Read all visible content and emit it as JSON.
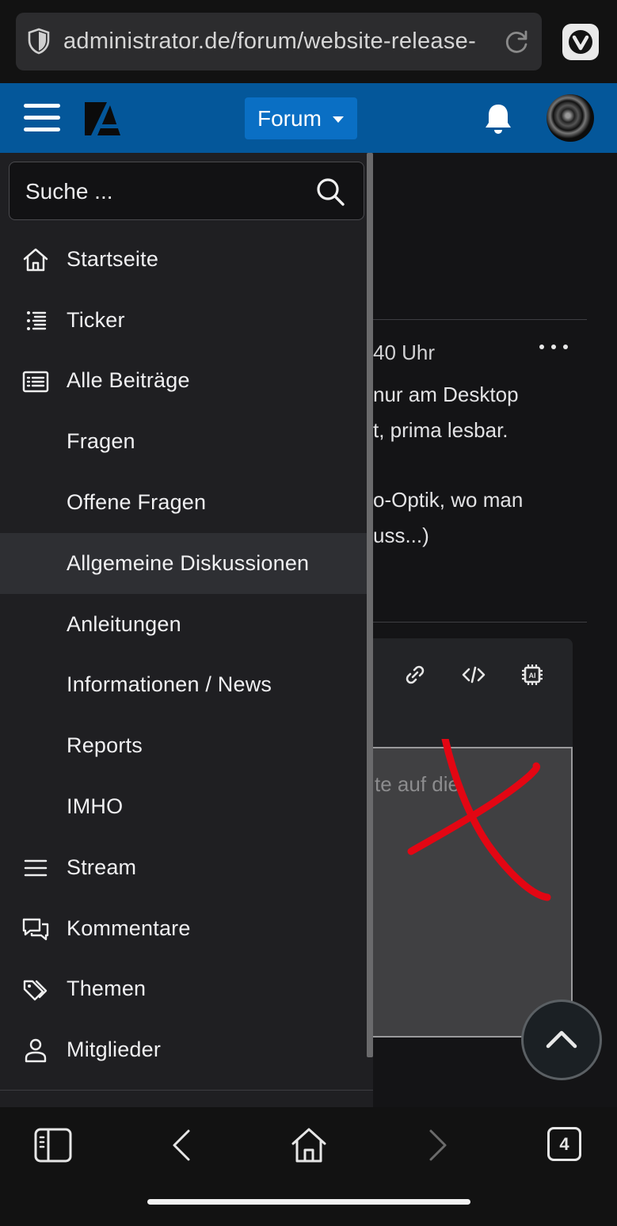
{
  "browser": {
    "url": "administrator.de/forum/website-release-",
    "tab_count": "4"
  },
  "header": {
    "forum_button": "Forum"
  },
  "search": {
    "placeholder": "Suche ..."
  },
  "menu": {
    "items": [
      {
        "label": "Startseite",
        "icon": "home-icon"
      },
      {
        "label": "Ticker",
        "icon": "ticker-list-icon"
      },
      {
        "label": "Alle Beiträge",
        "icon": "list-box-icon"
      },
      {
        "label": "Fragen"
      },
      {
        "label": "Offene Fragen"
      },
      {
        "label": "Allgemeine Diskussionen",
        "active": true
      },
      {
        "label": "Anleitungen"
      },
      {
        "label": "Informationen / News"
      },
      {
        "label": "Reports"
      },
      {
        "label": "IMHO"
      },
      {
        "label": "Stream",
        "icon": "stream-lines-icon"
      },
      {
        "label": "Kommentare",
        "icon": "comments-icon"
      },
      {
        "label": "Themen",
        "icon": "tags-icon"
      },
      {
        "label": "Mitglieder",
        "icon": "user-icon"
      }
    ]
  },
  "content": {
    "time": "40 Uhr",
    "lines": [
      "nur am Desktop",
      "t, prima lesbar.",
      "o-Optik, wo man",
      "uss...)"
    ],
    "editor_placeholder": "te auf die"
  },
  "colors": {
    "header_bg": "#04579a",
    "forum_button_bg": "#0a6fc4",
    "drawer_bg": "#1f1f22",
    "active_item_bg": "#2e2f33",
    "annotation_red": "#e30613"
  }
}
